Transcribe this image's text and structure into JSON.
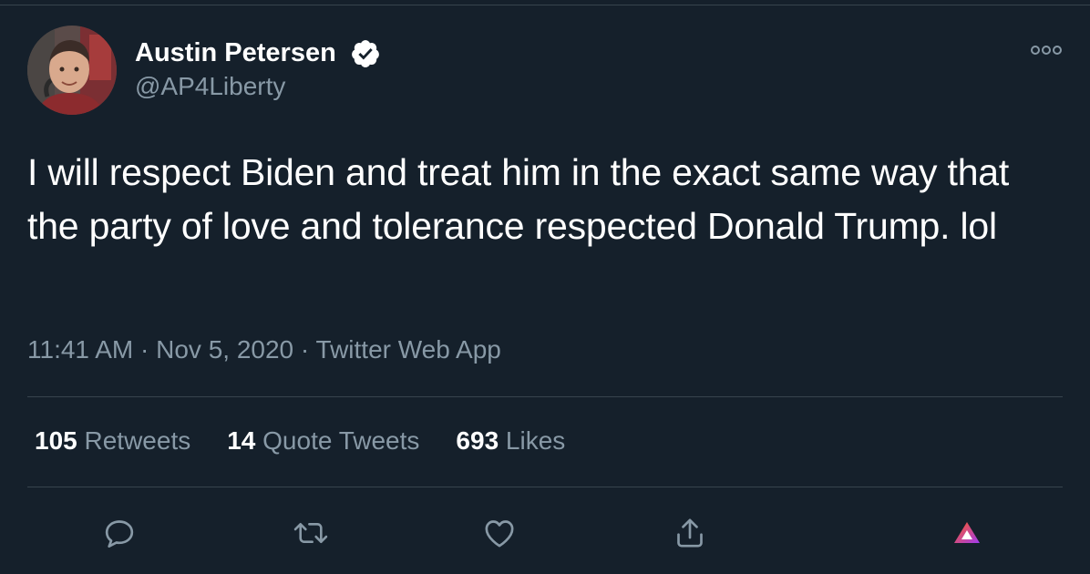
{
  "author": {
    "name": "Austin Petersen",
    "handle": "@AP4Liberty",
    "verified": true
  },
  "tweet": {
    "text": "I will respect Biden and treat him in the exact same way that the party of love and tolerance respected Donald Trump. lol",
    "time": "11:41 AM",
    "date": "Nov 5, 2020",
    "source": "Twitter Web App",
    "separator": "·"
  },
  "stats": {
    "retweets": {
      "count": "105",
      "label": "Retweets"
    },
    "quote_tweets": {
      "count": "14",
      "label": "Quote Tweets"
    },
    "likes": {
      "count": "693",
      "label": "Likes"
    }
  },
  "actions": [
    "reply-icon",
    "retweet-icon",
    "like-icon",
    "share-icon",
    "brave-icon"
  ],
  "colors": {
    "background": "#15202b",
    "text": "#ffffff",
    "secondary": "#8899a6",
    "divider": "#38444d",
    "verified_badge": "#ffffff"
  }
}
